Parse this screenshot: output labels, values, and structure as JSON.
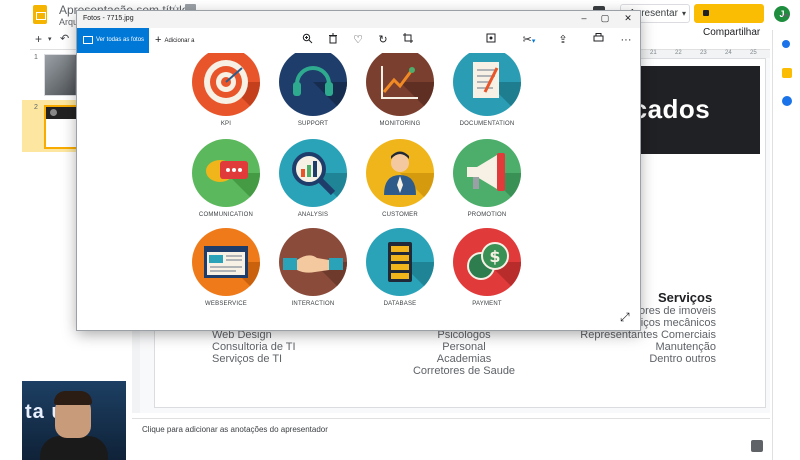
{
  "app": {
    "doc_title": "Apresentação sem título",
    "menu_file": "Arqui",
    "present_label": "Apresentar",
    "share_label": "Compartilhar",
    "avatar_initial": "J",
    "brand_color": "#fbbc04"
  },
  "toolbar": {
    "add": "+",
    "caret": "▾",
    "undo": "↶"
  },
  "ruler": {
    "marks": [
      "21",
      "22",
      "23",
      "24",
      "25"
    ]
  },
  "filmstrip": {
    "slides": [
      "1",
      "2"
    ]
  },
  "slide": {
    "banner_text": "rcados",
    "col1": [
      "Web Design",
      "Consultoria de TI",
      "Serviços de TI"
    ],
    "col2": [
      "Psicologos",
      "Personal",
      "Academias",
      "Corretores de Saude"
    ],
    "services_title": "Serviços",
    "col3": [
      "tores de imoveis",
      "viços mecânicos",
      "Representantes Comerciais",
      "Manutenção",
      "Dentro outros"
    ]
  },
  "notes": {
    "placeholder": "Clique para adicionar as anotações do apresentador"
  },
  "webcam": {
    "brand": "ta  us"
  },
  "viewer": {
    "title": "Fotos - 7715.jpg",
    "all_photos": "Ver todas as fotos",
    "add_to": "Adicionar a",
    "tiles": [
      {
        "label": "KPI",
        "bg": "#e8552b"
      },
      {
        "label": "SUPPORT",
        "bg": "#1f3d6b"
      },
      {
        "label": "MONITORING",
        "bg": "#7a3f2e"
      },
      {
        "label": "DOCUMENTATION",
        "bg": "#2a9db4"
      },
      {
        "label": "COMMUNICATION",
        "bg": "#5cb85c"
      },
      {
        "label": "ANALYSIS",
        "bg": "#2aa3b8"
      },
      {
        "label": "CUSTOMER",
        "bg": "#f0b51a"
      },
      {
        "label": "PROMOTION",
        "bg": "#4cae6a"
      },
      {
        "label": "WEBSERVICE",
        "bg": "#ef7a1a"
      },
      {
        "label": "INTERACTION",
        "bg": "#8a4b3a"
      },
      {
        "label": "DATABASE",
        "bg": "#2aa3b8"
      },
      {
        "label": "PAYMENT",
        "bg": "#e03a3a"
      }
    ]
  }
}
